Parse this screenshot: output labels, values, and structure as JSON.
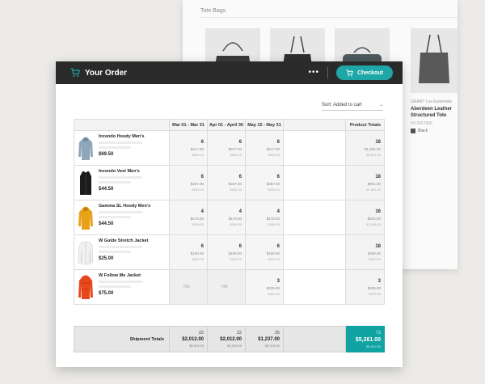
{
  "background_window": {
    "section_title": "Tote Bags",
    "featured": {
      "brand": "GRANT Lux Essentials",
      "name_line1": "Aberdeen Leather",
      "name_line2": "Structured Tote",
      "sku": "HC2567800",
      "color_label": "Black"
    }
  },
  "header": {
    "title": "Your Order",
    "checkout_label": "Checkout"
  },
  "sort": {
    "label": "Sort: Added to cart"
  },
  "columns": [
    "Mar 01 - Mar 31",
    "Apr 01 - April 30",
    "May 15 - May 31",
    "Product Totals"
  ],
  "products": [
    {
      "name": "Incendo Hoody Men's",
      "price": "$69.50",
      "cells": [
        {
          "qty": "6",
          "amt": "$417.00",
          "amt2": "$834.00"
        },
        {
          "qty": "6",
          "amt": "$417.00",
          "amt2": "$834.00"
        },
        {
          "qty": "6",
          "amt": "$417.00",
          "amt2": "$834.00"
        }
      ],
      "total": {
        "qty": "18",
        "amt": "$1,251.00",
        "amt2": "$2,502.00"
      }
    },
    {
      "name": "Incendo Vest Men's",
      "price": "$44.50",
      "cells": [
        {
          "qty": "6",
          "amt": "$267.00",
          "amt2": "$534.00"
        },
        {
          "qty": "6",
          "amt": "$267.00",
          "amt2": "$534.00"
        },
        {
          "qty": "6",
          "amt": "$267.00",
          "amt2": "$534.00"
        }
      ],
      "total": {
        "qty": "18",
        "amt": "$801.00",
        "amt2": "$1,602.00"
      }
    },
    {
      "name": "Gamma SL Hoody Men's",
      "price": "$44.50",
      "cells": [
        {
          "qty": "4",
          "amt": "$178.00",
          "amt2": "$356.00"
        },
        {
          "qty": "4",
          "amt": "$178.00",
          "amt2": "$356.00"
        },
        {
          "qty": "4",
          "amt": "$178.00",
          "amt2": "$356.00"
        }
      ],
      "total": {
        "qty": "16",
        "amt": "$534.00",
        "amt2": "$1,068.00"
      }
    },
    {
      "name": "W Guide Stretch Jacket",
      "price": "$25.00",
      "cells": [
        {
          "qty": "6",
          "amt": "$150.00",
          "amt2": "$300.00"
        },
        {
          "qty": "6",
          "amt": "$150.00",
          "amt2": "$300.00"
        },
        {
          "qty": "6",
          "amt": "$150.00",
          "amt2": "$300.00"
        }
      ],
      "total": {
        "qty": "18",
        "amt": "$450.00",
        "amt2": "$900.00"
      }
    },
    {
      "name": "W Follow Me Jacket",
      "price": "$75.00",
      "cells": [
        {
          "na": "NA"
        },
        {
          "na": "NA"
        },
        {
          "qty": "3",
          "amt": "$225.00",
          "amt2": "$450.00"
        }
      ],
      "total": {
        "qty": "3",
        "amt": "$225.00",
        "amt2": "$450.00"
      }
    }
  ],
  "shipment": {
    "label": "Shipment Totals",
    "periods": [
      {
        "qty": "22",
        "amt": "$2,012.00",
        "amt2": "$5,024.00"
      },
      {
        "qty": "22",
        "amt": "$2,012.00",
        "amt2": "$2,024.00"
      },
      {
        "qty": "25",
        "amt": "$1,237.00",
        "amt2": "$2,474.00"
      }
    ],
    "grand": {
      "qty": "73",
      "amt": "$5,261.00",
      "amt2": "$6,522.00"
    }
  },
  "colors": {
    "accent": "#1fa6a6",
    "header_bg": "#2a2a2a",
    "product_colors": [
      "#8fa5b8",
      "#1c1c1c",
      "#e8a21a",
      "#f2f2f2",
      "#e8461b"
    ]
  }
}
